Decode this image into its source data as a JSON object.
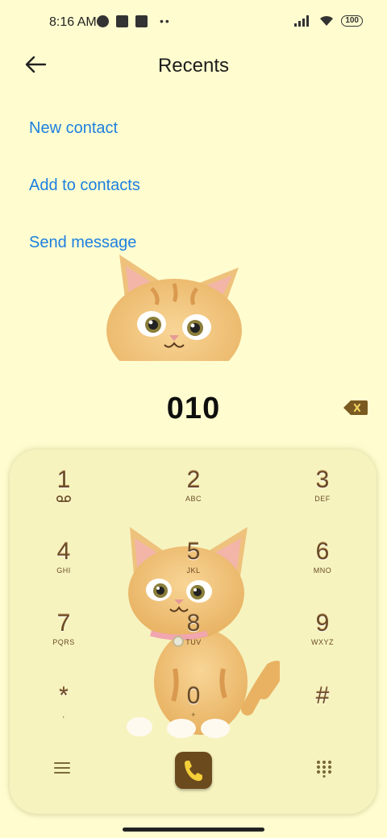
{
  "status_bar": {
    "time": "8:16 AM",
    "battery": "100"
  },
  "header": {
    "title": "Recents"
  },
  "actions": {
    "new_contact": "New contact",
    "add_to_contacts": "Add to contacts",
    "send_message": "Send message"
  },
  "dialer": {
    "number": "010"
  },
  "keypad": {
    "keys": [
      {
        "digit": "1",
        "letters": ""
      },
      {
        "digit": "2",
        "letters": "ABC"
      },
      {
        "digit": "3",
        "letters": "DEF"
      },
      {
        "digit": "4",
        "letters": "GHI"
      },
      {
        "digit": "5",
        "letters": "JKL"
      },
      {
        "digit": "6",
        "letters": "MNO"
      },
      {
        "digit": "7",
        "letters": "PQRS"
      },
      {
        "digit": "8",
        "letters": "TUV"
      },
      {
        "digit": "9",
        "letters": "WXYZ"
      },
      {
        "digit": "*",
        "letters": ","
      },
      {
        "digit": "0",
        "letters": "+"
      },
      {
        "digit": "#",
        "letters": ""
      }
    ]
  },
  "colors": {
    "accent": "#1d7fe0",
    "background": "#fffdd0",
    "key_text": "#6b4a25",
    "call_button": "#6b4a1e"
  },
  "icons": [
    "back-arrow-icon",
    "voicemail-icon",
    "backspace-icon",
    "menu-icon",
    "phone-icon",
    "dialpad-icon",
    "signal-icon",
    "wifi-icon"
  ]
}
